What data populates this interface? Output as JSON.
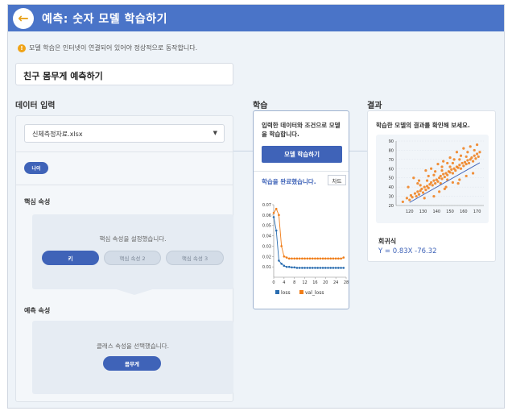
{
  "header": {
    "title": "예측: 숫자 모델 학습하기",
    "back_icon": "arrow-left-icon"
  },
  "notice": {
    "text": "모델 학습은 인터넷이 연결되어 있어야 정상적으로 동작합니다.",
    "icon": "warning-icon"
  },
  "model_name": {
    "value": "친구 몸무게 예측하기"
  },
  "sections": {
    "data_input": "데이터 입력",
    "training": "학습",
    "result": "결과"
  },
  "data_input": {
    "file_value": "신체측정자료.xlsx",
    "attribute_button": "나이",
    "core_attr_title": "핵심 속성",
    "core_attr_msg": "핵심 속성을 설정했습니다.",
    "core_attrs": [
      "키",
      "핵심 속성 2",
      "핵심 속성 3"
    ],
    "pred_attr_title": "예측 속성",
    "pred_attr_msg": "클래스 속성을 선택했습니다.",
    "pred_attr_value": "몸무게"
  },
  "training": {
    "description": "입력한 데이터와 조건으로 모델을 학습합니다.",
    "button": "모델 학습하기",
    "status": "학습을 완료했습니다.",
    "chart_button": "차트"
  },
  "result": {
    "description": "학습한 모델의 결과를 확인해 보세요.",
    "regression_title": "회귀식",
    "regression_eq": "Y = 0.83X -76.32"
  },
  "chart_data": [
    {
      "type": "line",
      "title": "",
      "x": [
        0,
        1,
        2,
        3,
        4,
        5,
        6,
        7,
        8,
        9,
        10,
        11,
        12,
        13,
        14,
        15,
        16,
        17,
        18,
        19,
        20,
        21,
        22,
        23,
        24,
        25,
        26,
        27
      ],
      "xticks": [
        0,
        4,
        8,
        12,
        16,
        20,
        24,
        28
      ],
      "ylim": [
        0,
        0.07
      ],
      "yticks": [
        0.01,
        0.02,
        0.03,
        0.04,
        0.05,
        0.06,
        0.07
      ],
      "series": [
        {
          "name": "loss",
          "color": "#2a6db0",
          "values": [
            0.058,
            0.045,
            0.016,
            0.013,
            0.011,
            0.01,
            0.01,
            0.0095,
            0.0095,
            0.009,
            0.009,
            0.009,
            0.009,
            0.009,
            0.009,
            0.009,
            0.009,
            0.009,
            0.009,
            0.009,
            0.009,
            0.009,
            0.009,
            0.009,
            0.009,
            0.009,
            0.009,
            0.009
          ]
        },
        {
          "name": "val_loss",
          "color": "#f07d18",
          "values": [
            0.062,
            0.066,
            0.06,
            0.03,
            0.02,
            0.019,
            0.018,
            0.018,
            0.018,
            0.018,
            0.018,
            0.018,
            0.018,
            0.018,
            0.018,
            0.018,
            0.018,
            0.018,
            0.018,
            0.018,
            0.018,
            0.018,
            0.018,
            0.018,
            0.018,
            0.018,
            0.018,
            0.019
          ]
        }
      ],
      "legend": "bottom"
    },
    {
      "type": "scatter",
      "title": "",
      "xlim": [
        110,
        175
      ],
      "ylim": [
        20,
        90
      ],
      "xticks": [
        120,
        130,
        140,
        150,
        160,
        170
      ],
      "yticks": [
        20,
        30,
        40,
        50,
        60,
        70,
        80,
        90
      ],
      "regression": {
        "slope": 0.83,
        "intercept": -76.32,
        "color": "#3f63b8"
      },
      "point_color": "#f07d18",
      "points": [
        [
          115,
          24
        ],
        [
          118,
          28
        ],
        [
          120,
          26
        ],
        [
          121,
          31
        ],
        [
          122,
          29
        ],
        [
          124,
          33
        ],
        [
          125,
          30
        ],
        [
          126,
          35
        ],
        [
          127,
          32
        ],
        [
          128,
          36
        ],
        [
          129,
          38
        ],
        [
          130,
          34
        ],
        [
          131,
          40
        ],
        [
          132,
          37
        ],
        [
          133,
          41
        ],
        [
          134,
          39
        ],
        [
          135,
          43
        ],
        [
          136,
          45
        ],
        [
          137,
          42
        ],
        [
          138,
          47
        ],
        [
          139,
          44
        ],
        [
          140,
          48
        ],
        [
          141,
          46
        ],
        [
          142,
          50
        ],
        [
          143,
          52
        ],
        [
          144,
          49
        ],
        [
          145,
          54
        ],
        [
          146,
          51
        ],
        [
          147,
          55
        ],
        [
          148,
          53
        ],
        [
          149,
          57
        ],
        [
          150,
          56
        ],
        [
          151,
          59
        ],
        [
          152,
          55
        ],
        [
          153,
          60
        ],
        [
          154,
          58
        ],
        [
          155,
          62
        ],
        [
          156,
          61
        ],
        [
          157,
          64
        ],
        [
          158,
          60
        ],
        [
          159,
          66
        ],
        [
          160,
          63
        ],
        [
          161,
          67
        ],
        [
          162,
          65
        ],
        [
          163,
          69
        ],
        [
          164,
          66
        ],
        [
          165,
          70
        ],
        [
          166,
          72
        ],
        [
          167,
          68
        ],
        [
          168,
          74
        ],
        [
          169,
          71
        ],
        [
          170,
          76
        ],
        [
          171,
          73
        ],
        [
          172,
          78
        ],
        [
          123,
          50
        ],
        [
          127,
          47
        ],
        [
          132,
          58
        ],
        [
          136,
          60
        ],
        [
          141,
          65
        ],
        [
          145,
          68
        ],
        [
          150,
          72
        ],
        [
          155,
          78
        ],
        [
          160,
          82
        ],
        [
          165,
          84
        ],
        [
          170,
          86
        ],
        [
          119,
          40
        ],
        [
          126,
          44
        ],
        [
          134,
          52
        ],
        [
          139,
          57
        ],
        [
          144,
          62
        ],
        [
          148,
          66
        ],
        [
          153,
          70
        ],
        [
          158,
          74
        ],
        [
          163,
          78
        ],
        [
          168,
          80
        ],
        [
          138,
          30
        ],
        [
          142,
          35
        ],
        [
          147,
          40
        ],
        [
          152,
          45
        ],
        [
          157,
          48
        ],
        [
          162,
          52
        ],
        [
          167,
          55
        ],
        [
          131,
          28
        ],
        [
          146,
          38
        ],
        [
          156,
          44
        ],
        [
          150,
          62
        ],
        [
          144,
          58
        ],
        [
          138,
          53
        ],
        [
          133,
          47
        ],
        [
          128,
          42
        ],
        [
          152,
          66
        ],
        [
          157,
          70
        ],
        [
          162,
          73
        ],
        [
          148,
          48
        ],
        [
          143,
          44
        ]
      ]
    }
  ]
}
